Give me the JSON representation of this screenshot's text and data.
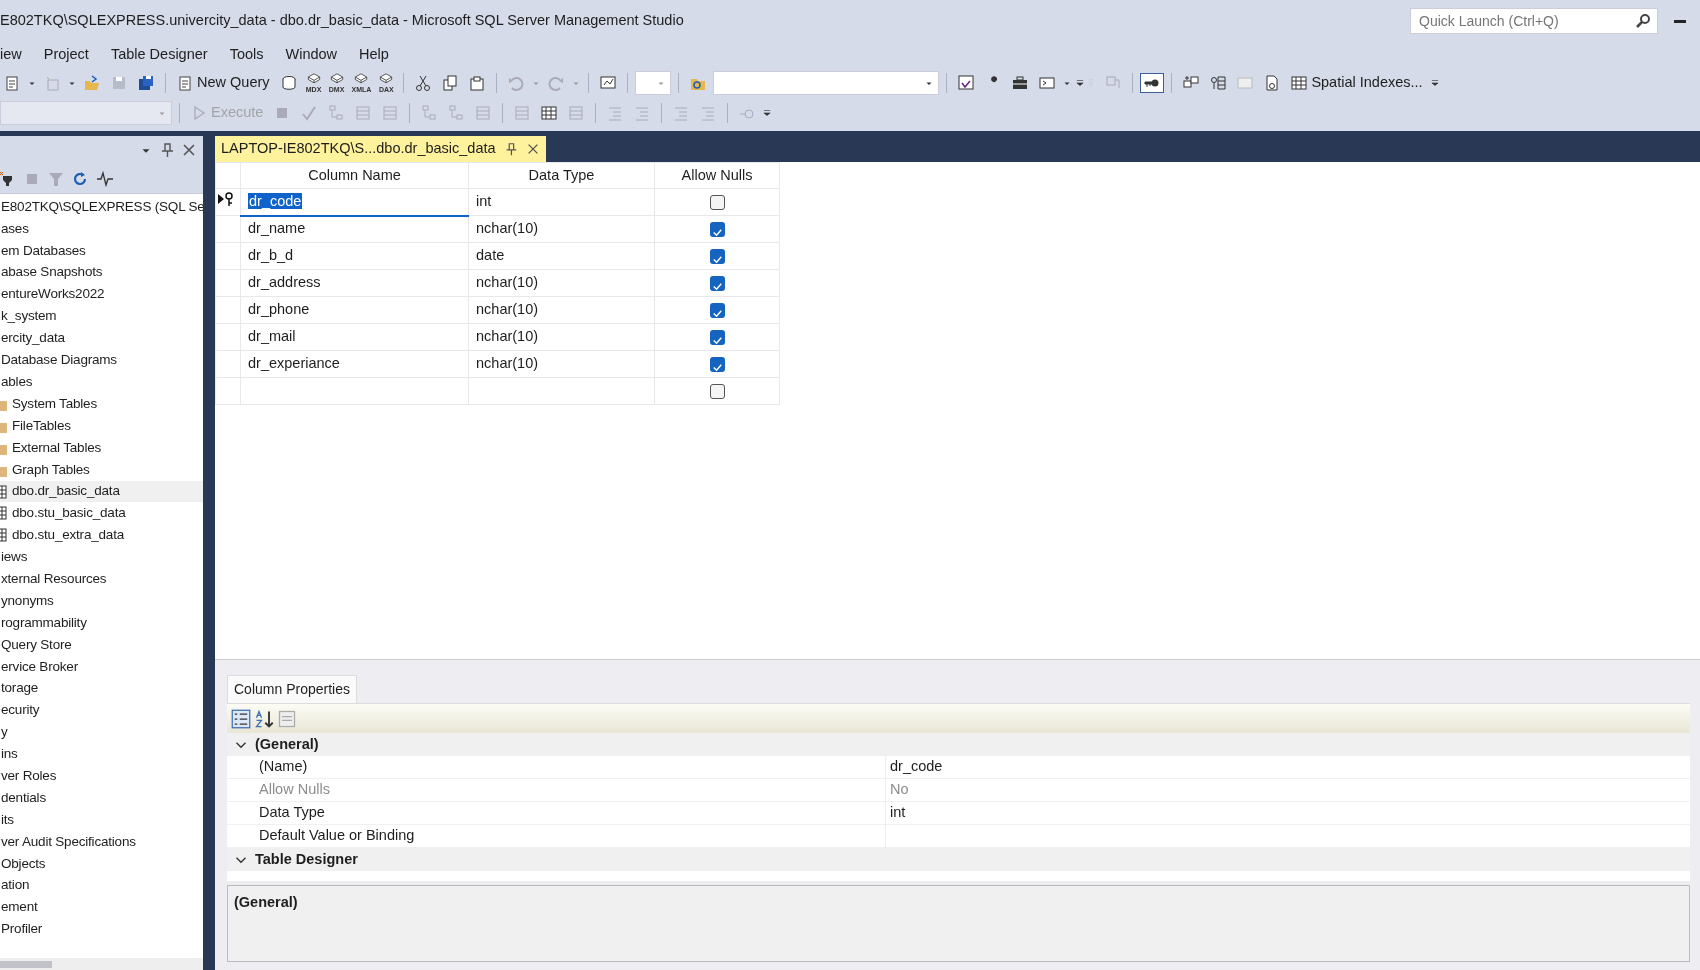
{
  "window": {
    "title": "E802TKQ\\SQLEXPRESS.univercity_data - dbo.dr_basic_data - Microsoft SQL Server Management Studio",
    "quick_launch": {
      "placeholder": "Quick Launch (Ctrl+Q)"
    }
  },
  "menu": [
    "iew",
    "Project",
    "Table Designer",
    "Tools",
    "Window",
    "Help"
  ],
  "toolbar": {
    "new_query": {
      "label": "New Query",
      "disabled": false
    },
    "query_types": [
      "MDX",
      "DMX",
      "XMLA",
      "DAX"
    ],
    "execute": {
      "label": "Execute",
      "disabled": true
    },
    "primary_key": {
      "pressed": true
    },
    "spatial_indexes": {
      "label": "Spatial Indexes...",
      "disabled": false
    }
  },
  "object_explorer": {
    "tree": [
      {
        "label": "E802TKQ\\SQLEXPRESS (SQL Se",
        "selected": false,
        "children": [
          {
            "label": "ases",
            "selected": false,
            "children": [
              {
                "label": "em Databases",
                "selected": false
              },
              {
                "label": "abase Snapshots",
                "selected": false
              },
              {
                "label": "entureWorks2022",
                "selected": false
              },
              {
                "label": "k_system",
                "selected": false
              },
              {
                "label": "ercity_data",
                "selected": false,
                "children": [
                  {
                    "label": "Database Diagrams",
                    "selected": false
                  },
                  {
                    "label": "ables",
                    "selected": false,
                    "children": [
                      {
                        "label": "System Tables",
                        "kind": "folder",
                        "selected": false
                      },
                      {
                        "label": "FileTables",
                        "kind": "folder",
                        "selected": false
                      },
                      {
                        "label": "External Tables",
                        "kind": "folder",
                        "selected": false
                      },
                      {
                        "label": "Graph Tables",
                        "kind": "folder",
                        "selected": false
                      },
                      {
                        "label": "dbo.dr_basic_data",
                        "kind": "table",
                        "selected": true
                      },
                      {
                        "label": "dbo.stu_basic_data",
                        "kind": "table",
                        "selected": false
                      },
                      {
                        "label": "dbo.stu_extra_data",
                        "kind": "table",
                        "selected": false
                      }
                    ]
                  },
                  {
                    "label": "iews",
                    "selected": false
                  },
                  {
                    "label": "xternal Resources",
                    "selected": false
                  },
                  {
                    "label": "ynonyms",
                    "selected": false
                  },
                  {
                    "label": "rogrammability",
                    "selected": false
                  },
                  {
                    "label": "Query Store",
                    "selected": false
                  },
                  {
                    "label": "ervice Broker",
                    "selected": false
                  },
                  {
                    "label": "torage",
                    "selected": false
                  },
                  {
                    "label": "ecurity",
                    "selected": false
                  }
                ]
              }
            ]
          },
          {
            "label": "y",
            "selected": false,
            "children": [
              {
                "label": "ins",
                "selected": false
              },
              {
                "label": "ver Roles",
                "selected": false
              },
              {
                "label": "dentials",
                "selected": false
              },
              {
                "label": "its",
                "selected": false
              },
              {
                "label": "ver Audit Specifications",
                "selected": false
              }
            ]
          },
          {
            "label": "Objects",
            "selected": false
          },
          {
            "label": "ation",
            "selected": false
          },
          {
            "label": "ement",
            "selected": false
          },
          {
            "label": "Profiler",
            "selected": false
          }
        ]
      }
    ]
  },
  "document_tab": {
    "label": "LAPTOP-IE802TKQ\\S...dbo.dr_basic_data",
    "selected": true
  },
  "table": {
    "columns": [
      "Column Name",
      "Data Type",
      "Allow Nulls"
    ],
    "rows": [
      {
        "name": "dr_code",
        "type": "int",
        "allow_nulls": false,
        "primary_key": true,
        "selected": true
      },
      {
        "name": "dr_name",
        "type": "nchar(10)",
        "allow_nulls": true,
        "primary_key": false,
        "selected": false
      },
      {
        "name": "dr_b_d",
        "type": "date",
        "allow_nulls": true,
        "primary_key": false,
        "selected": false
      },
      {
        "name": "dr_address",
        "type": "nchar(10)",
        "allow_nulls": true,
        "primary_key": false,
        "selected": false
      },
      {
        "name": "dr_phone",
        "type": "nchar(10)",
        "allow_nulls": true,
        "primary_key": false,
        "selected": false
      },
      {
        "name": "dr_mail",
        "type": "nchar(10)",
        "allow_nulls": true,
        "primary_key": false,
        "selected": false
      },
      {
        "name": "dr_experiance",
        "type": "nchar(10)",
        "allow_nulls": true,
        "primary_key": false,
        "selected": false
      }
    ],
    "new_row": {
      "allow_nulls": false
    }
  },
  "column_properties": {
    "tab": "Column Properties",
    "groups": [
      {
        "title": "(General)",
        "expanded": true,
        "rows": [
          {
            "name": "(Name)",
            "value": "dr_code",
            "disabled": false
          },
          {
            "name": "Allow Nulls",
            "value": "No",
            "disabled": true
          },
          {
            "name": "Data Type",
            "value": "int",
            "disabled": false
          },
          {
            "name": "Default Value or Binding",
            "disabled": false
          }
        ]
      },
      {
        "title": "Table Designer",
        "expanded": true
      }
    ],
    "description": "(General)"
  }
}
